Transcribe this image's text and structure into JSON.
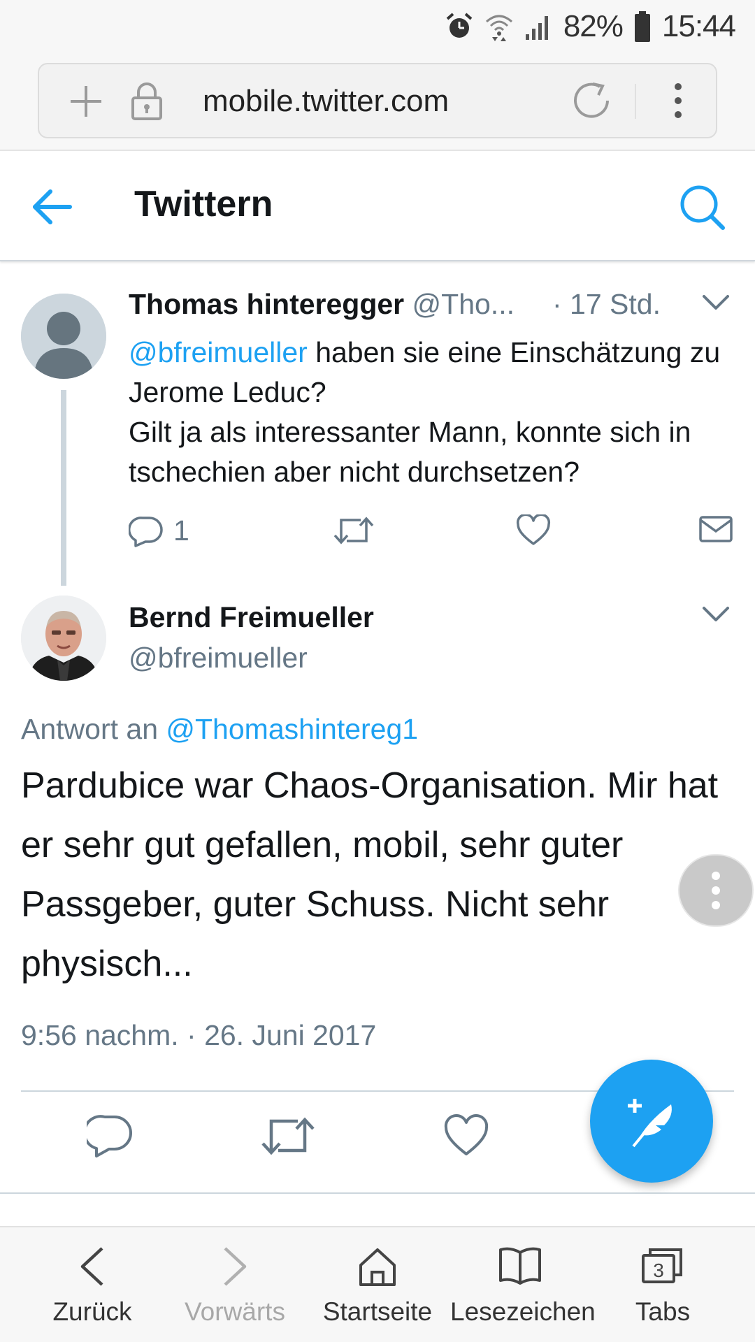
{
  "status_bar": {
    "battery_percent": "82%",
    "time": "15:44",
    "icons": [
      "alarm-icon",
      "wifi-icon",
      "signal-icon",
      "battery-icon"
    ]
  },
  "browser": {
    "url": "mobile.twitter.com",
    "icons": [
      "new-tab-icon",
      "lock-icon",
      "reload-icon",
      "more-vert-icon"
    ]
  },
  "header": {
    "title": "Twittern"
  },
  "tweet_parent": {
    "author_name": "Thomas hinteregger",
    "author_handle": "@Tho...",
    "time": "· 17 Std.",
    "mention": "@bfreimueller",
    "text_after_mention": " haben sie eine Einschätzung zu Jerome Leduc?",
    "text_line2": "Gilt ja als interessanter Mann, konnte sich in tschechien aber nicht durchsetzen?",
    "reply_count": "1"
  },
  "tweet_main": {
    "author_name": "Bernd Freimueller",
    "author_handle": "@bfreimueller",
    "reply_prefix": "Antwort an ",
    "reply_to": "@Thomashintereg1",
    "text": "Pardubice war Chaos-Organisation. Mir hat er sehr gut gefallen, mobil, sehr guter Passgeber, guter Schuss. Nicht sehr physisch...",
    "timestamp": "9:56 nachm. · 26. Juni 2017"
  },
  "bottom_nav": {
    "back": "Zurück",
    "forward": "Vorwärts",
    "home": "Startseite",
    "bookmarks": "Lesezeichen",
    "tabs": "Tabs",
    "tab_count": "3"
  },
  "colors": {
    "accent": "#1da1f2",
    "secondary_text": "#657786",
    "primary_text": "#14171a",
    "divider": "#ccd6dd"
  }
}
